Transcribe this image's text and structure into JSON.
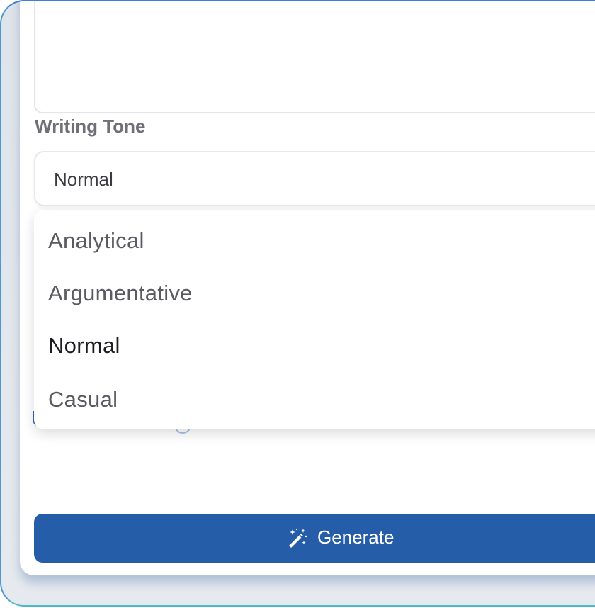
{
  "form": {
    "tone_label": "Writing Tone",
    "tone_selected": "Normal",
    "tone_options": [
      "Analytical",
      "Argumentative",
      "Normal",
      "Casual"
    ],
    "generate_label": "Generate",
    "generate_icon": "magic-wand-icon"
  },
  "colors": {
    "primary": "#255da9",
    "frame_border": "#3d7fd1",
    "label": "#6f6f78"
  }
}
